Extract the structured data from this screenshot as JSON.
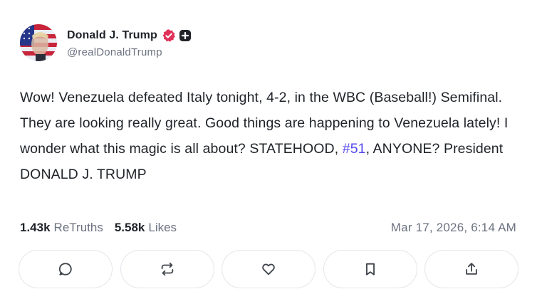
{
  "author": {
    "display_name": "Donald J. Trump",
    "handle": "@realDonaldTrump",
    "verified_badge_icon": "verified-check-icon",
    "plus_badge_icon": "plus-badge-icon",
    "verified_color": "#e0315a"
  },
  "post": {
    "text_before": "Wow! Venezuela defeated Italy tonight, 4-2, in the WBC (Baseball!) Semifinal. They are looking really great. Good things are happening to Venezuela lately! I wonder what this magic is all about? STATEHOOD, ",
    "hashtag": "#51",
    "text_after": ", ANYONE? President DONALD J. TRUMP",
    "hashtag_color": "#5448ee"
  },
  "stats": {
    "retruths_count": "1.43k",
    "retruths_label": "ReTruths",
    "likes_count": "5.58k",
    "likes_label": "Likes",
    "timestamp": "Mar 17, 2026, 6:14 AM"
  },
  "actions": [
    {
      "icon": "reply-icon"
    },
    {
      "icon": "retruth-icon"
    },
    {
      "icon": "heart-icon"
    },
    {
      "icon": "bookmark-icon"
    },
    {
      "icon": "share-icon"
    }
  ]
}
